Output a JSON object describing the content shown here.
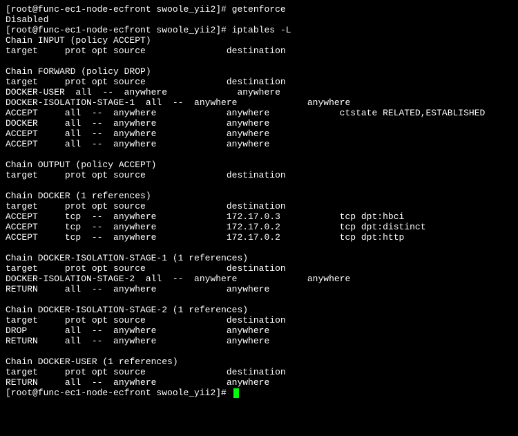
{
  "prompt_user": "root",
  "prompt_host": "func-ec1-node-ecfront",
  "prompt_cwd": "swoole_yii2",
  "prompt_text": "[root@func-ec1-node-ecfront swoole_yii2]# ",
  "cmd_getenforce": "getenforce",
  "getenforce_output": "Disabled",
  "cmd_iptables": "iptables -L",
  "chain_input_header": "Chain INPUT (policy ACCEPT)",
  "columns": "target     prot opt source               destination",
  "chain_forward_header": "Chain FORWARD (policy DROP)",
  "forward_rows": [
    "DOCKER-USER  all  --  anywhere             anywhere",
    "DOCKER-ISOLATION-STAGE-1  all  --  anywhere             anywhere",
    "ACCEPT     all  --  anywhere             anywhere             ctstate RELATED,ESTABLISHED",
    "DOCKER     all  --  anywhere             anywhere",
    "ACCEPT     all  --  anywhere             anywhere",
    "ACCEPT     all  --  anywhere             anywhere"
  ],
  "chain_output_header": "Chain OUTPUT (policy ACCEPT)",
  "chain_docker_header": "Chain DOCKER (1 references)",
  "docker_rows": [
    "ACCEPT     tcp  --  anywhere             172.17.0.3           tcp dpt:hbci",
    "ACCEPT     tcp  --  anywhere             172.17.0.2           tcp dpt:distinct",
    "ACCEPT     tcp  --  anywhere             172.17.0.2           tcp dpt:http"
  ],
  "chain_iso1_header": "Chain DOCKER-ISOLATION-STAGE-1 (1 references)",
  "iso1_rows": [
    "DOCKER-ISOLATION-STAGE-2  all  --  anywhere             anywhere",
    "RETURN     all  --  anywhere             anywhere"
  ],
  "chain_iso2_header": "Chain DOCKER-ISOLATION-STAGE-2 (1 references)",
  "iso2_rows": [
    "DROP       all  --  anywhere             anywhere",
    "RETURN     all  --  anywhere             anywhere"
  ],
  "chain_user_header": "Chain DOCKER-USER (1 references)",
  "user_rows": [
    "RETURN     all  --  anywhere             anywhere"
  ]
}
